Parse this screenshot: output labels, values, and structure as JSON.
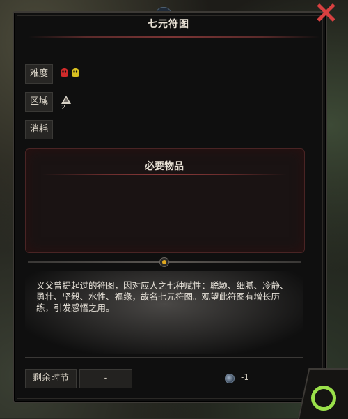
{
  "window": {
    "title": "七元符图"
  },
  "rows": [
    {
      "label": "难度"
    },
    {
      "label": "区域",
      "value": "2"
    },
    {
      "label": "消耗"
    }
  ],
  "difficulty_colors": [
    "#d02a2a",
    "#d8c020"
  ],
  "required_items": {
    "title": "必要物品"
  },
  "description": "义父曾提起过的符图，因对应人之七种赋性：聪颖、细腻、冷静、勇壮、坚毅、水性、福缘，故名七元符图。观望此符图有增长历练，引发感悟之用。",
  "footer": {
    "remaining_label": "剩余时节",
    "remaining_value": "-",
    "cost_value": "-1"
  },
  "icons": {
    "close": "close-icon",
    "confirm": "confirm-ring-icon",
    "region": "mountain-icon",
    "coin": "coin-icon"
  }
}
